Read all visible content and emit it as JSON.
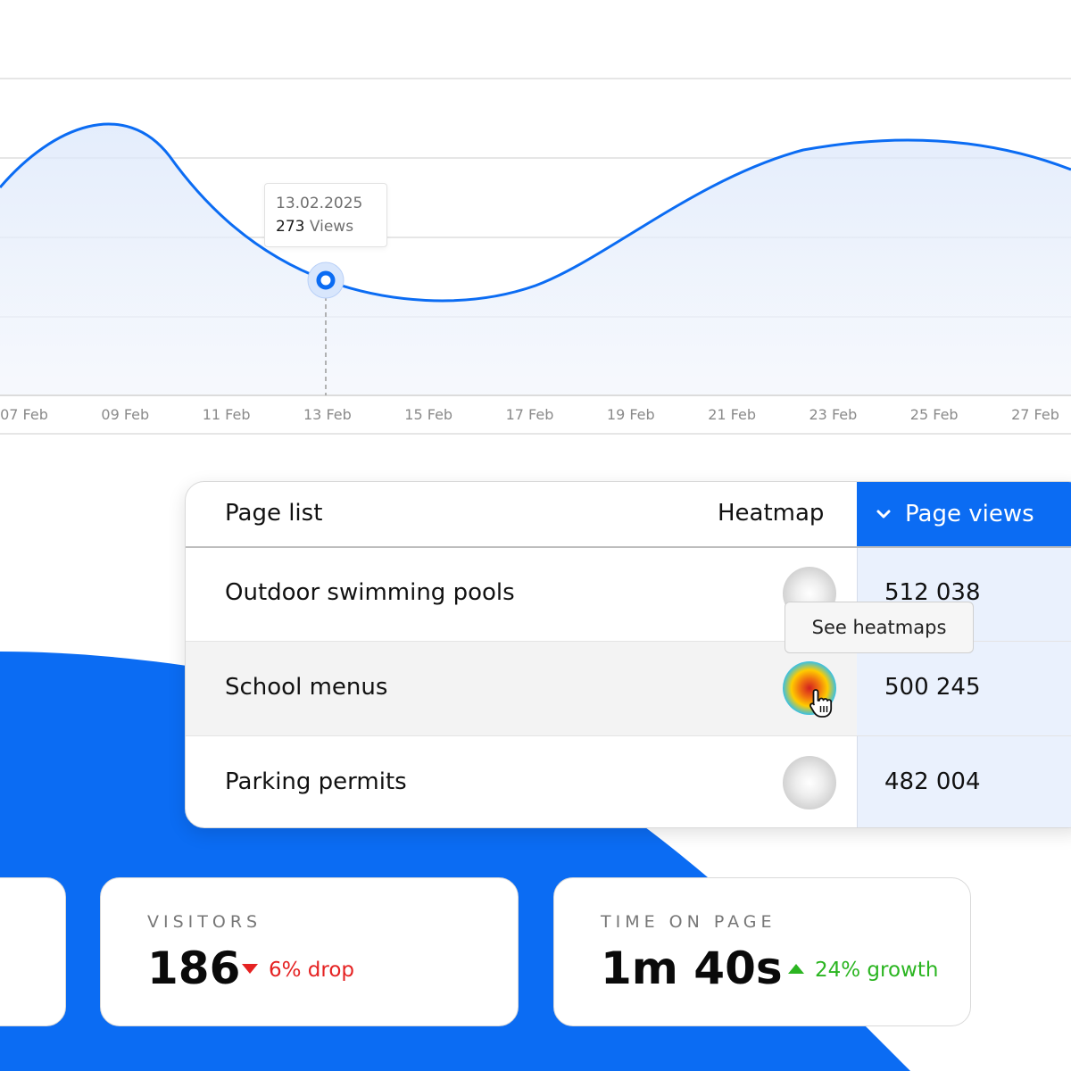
{
  "chart_data": {
    "type": "area",
    "x_tick_labels": [
      "07 Feb",
      "09 Feb",
      "11 Feb",
      "13 Feb",
      "15 Feb",
      "17 Feb",
      "19 Feb",
      "21 Feb",
      "23 Feb",
      "25 Feb",
      "27 Feb"
    ],
    "hover": {
      "date": "13.02.2025",
      "value": 273,
      "unit_label": "Views"
    },
    "line_color": "#0b6cf3",
    "grid": true
  },
  "table": {
    "headers": {
      "page_list": "Page list",
      "heatmap": "Heatmap",
      "page_views": "Page views"
    },
    "rows": [
      {
        "name": "Outdoor swimming pools",
        "views": "512 038",
        "heatmap_active": false
      },
      {
        "name": "School menus",
        "views": "500 245",
        "heatmap_active": true
      },
      {
        "name": "Parking permits",
        "views": "482 004",
        "heatmap_active": false
      }
    ],
    "heatmap_tooltip": "See heatmaps"
  },
  "stats": [
    {
      "label": "VISITORS",
      "value": "186",
      "change": "6% drop",
      "direction": "down",
      "color": "#e52222"
    },
    {
      "label": "TIME ON PAGE",
      "value": "1m 40s",
      "change": "24% growth",
      "direction": "up",
      "color": "#2bb521"
    }
  ],
  "colors": {
    "accent": "#0b6cf3",
    "highlight_column": "#eaf1fd"
  }
}
